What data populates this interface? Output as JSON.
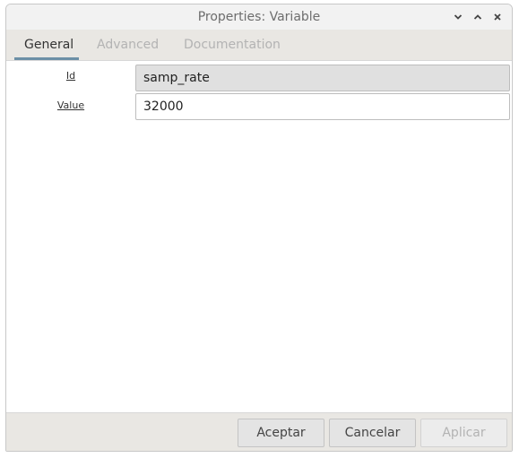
{
  "window": {
    "title": "Properties: Variable"
  },
  "tabs": [
    {
      "label": "General",
      "active": true
    },
    {
      "label": "Advanced",
      "active": false
    },
    {
      "label": "Documentation",
      "active": false
    }
  ],
  "properties": {
    "id": {
      "label": "Id",
      "value": "samp_rate"
    },
    "value": {
      "label": "Value",
      "value": "32000"
    }
  },
  "buttons": {
    "accept": "Aceptar",
    "cancel": "Cancelar",
    "apply": "Aplicar"
  },
  "icons": {
    "minimize": "chevron-down-icon",
    "maximize": "chevron-up-icon",
    "close": "close-icon"
  },
  "colors": {
    "tab_accent": "#6c8fa6"
  }
}
